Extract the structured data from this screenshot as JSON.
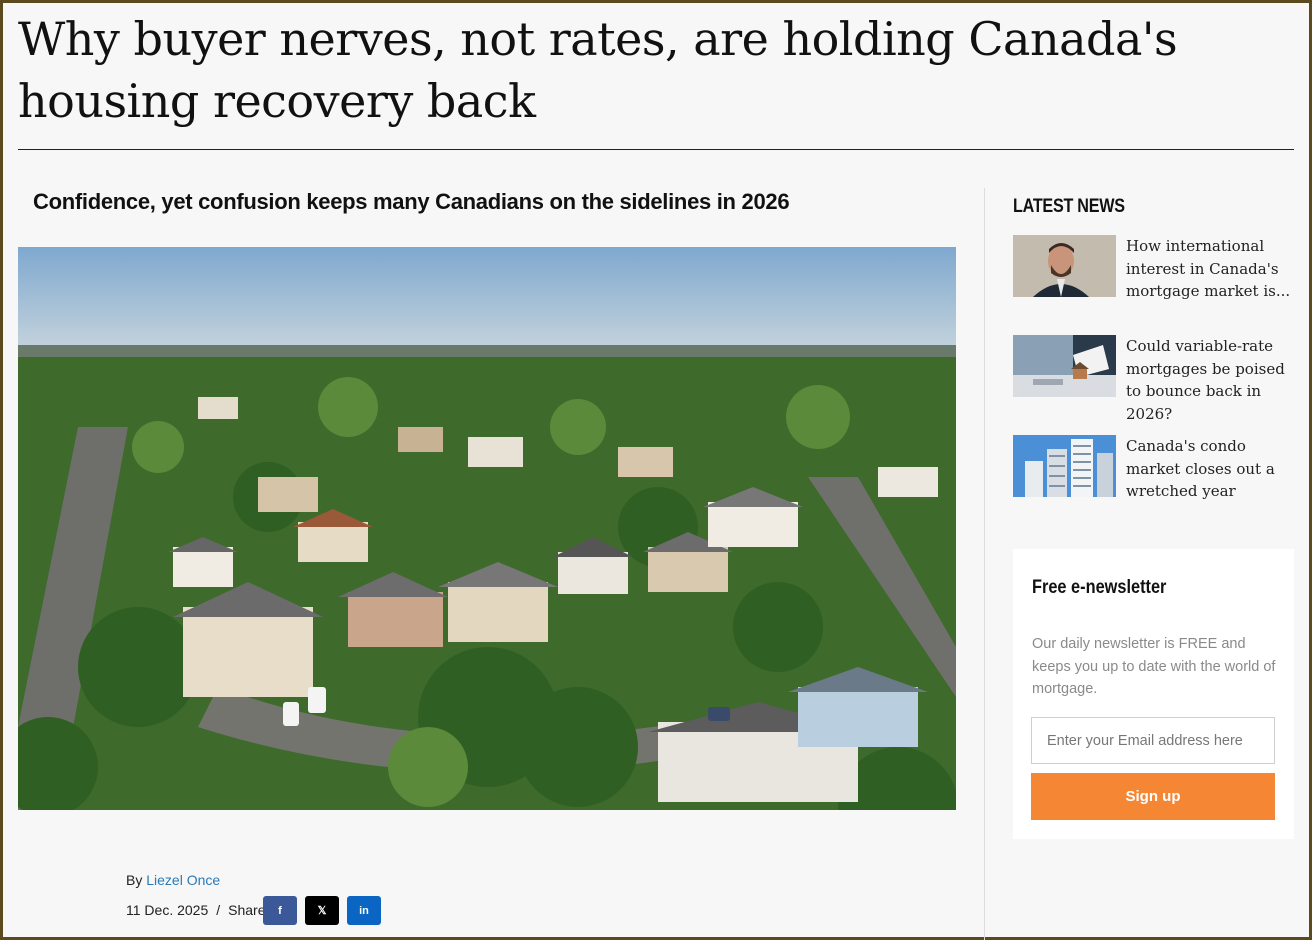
{
  "article": {
    "headline": "Why buyer nerves, not rates, are holding Canada's housing recovery back",
    "subheadline": "Confidence, yet confusion keeps many Canadians on the sidelines in 2026",
    "byline_prefix": "By",
    "author": "Liezel Once",
    "date": "11 Dec. 2025",
    "separator": "/",
    "share_label": "Share",
    "share_buttons": [
      {
        "network": "facebook",
        "glyph": "f",
        "color": "#3b5998"
      },
      {
        "network": "x",
        "glyph": "𝕏",
        "color": "#000000"
      },
      {
        "network": "linkedin",
        "glyph": "in",
        "color": "#0a66c2"
      }
    ]
  },
  "sidebar": {
    "latest_title": "LATEST NEWS",
    "items": [
      {
        "title": "How international interest in Canada's mortgage market is..."
      },
      {
        "title": "Could variable-rate mortgages be poised to bounce back in 2026?"
      },
      {
        "title": "Canada's condo market closes out a wretched year"
      }
    ],
    "newsletter": {
      "title": "Free e-newsletter",
      "description": "Our daily newsletter is FREE and keeps you up to date with the world of mortgage.",
      "email_placeholder": "Enter your Email address here",
      "signup_label": "Sign up",
      "accent": "#f58634"
    }
  }
}
